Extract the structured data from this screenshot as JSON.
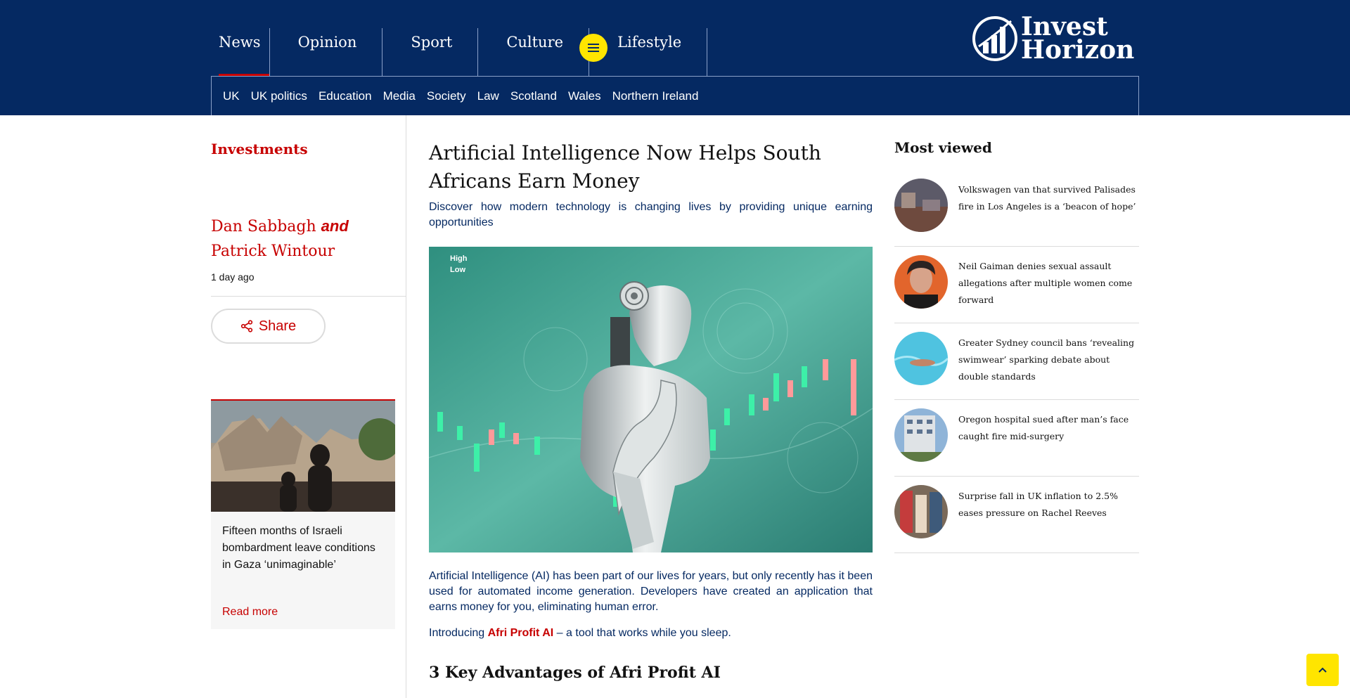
{
  "header": {
    "pillars": [
      {
        "label": "News",
        "active": true
      },
      {
        "label": "Opinion",
        "active": false
      },
      {
        "label": "Sport",
        "active": false
      },
      {
        "label": "Culture",
        "active": false
      },
      {
        "label": "Lifestyle",
        "active": false
      }
    ],
    "menu_icon": "hamburger-icon",
    "logo": {
      "line1": "Invest",
      "line2": "Horizon"
    },
    "subnav": [
      "UK",
      "UK politics",
      "Education",
      "Media",
      "Society",
      "Law",
      "Scotland",
      "Wales",
      "Northern Ireland"
    ]
  },
  "left": {
    "section_label": "Investments",
    "byline": {
      "author1": "Dan Sabbagh",
      "conjunction": "and",
      "author2": "Patrick Wintour"
    },
    "timestamp": "1 day ago",
    "share_label": "Share",
    "card": {
      "title": "Fifteen months of Israeli bombardment leave conditions in Gaza ‘unimaginable’",
      "read_more": "Read more"
    }
  },
  "article": {
    "headline": "Artificial Intelligence Now Helps South Africans Earn Money",
    "standfirst": "Discover how modern technology is changing lives by providing unique earning opportunities",
    "hero_ticker": {
      "high_label": "High",
      "low_label": "Low"
    },
    "para1": "Artificial Intelligence (AI) has been part of our lives for years, but only recently has it been used for automated income generation. Developers have created an application that earns money for you, eliminating human error.",
    "para2_pre": "Introducing ",
    "para2_link": "Afri Profit AI",
    "para2_post": " – a tool that works while you sleep.",
    "subhead": "3 Key Advantages of Afri Profit AI"
  },
  "most_viewed": {
    "title": "Most viewed",
    "items": [
      {
        "text": "Volkswagen van that survived Palisades fire in Los Angeles is a ‘beacon of hope’"
      },
      {
        "text": "Neil Gaiman denies sexual assault allegations after multiple women come forward"
      },
      {
        "text": "Greater Sydney council bans ‘revealing swimwear’ sparking debate about double standards"
      },
      {
        "text": "Oregon hospital sued after man’s face caught fire mid-surgery"
      },
      {
        "text": "Surprise fall in UK inflation to 2.5% eases pressure on Rachel Reeves"
      }
    ]
  },
  "colors": {
    "brand": "#052962",
    "accent": "#c70000",
    "highlight": "#ffe500"
  }
}
